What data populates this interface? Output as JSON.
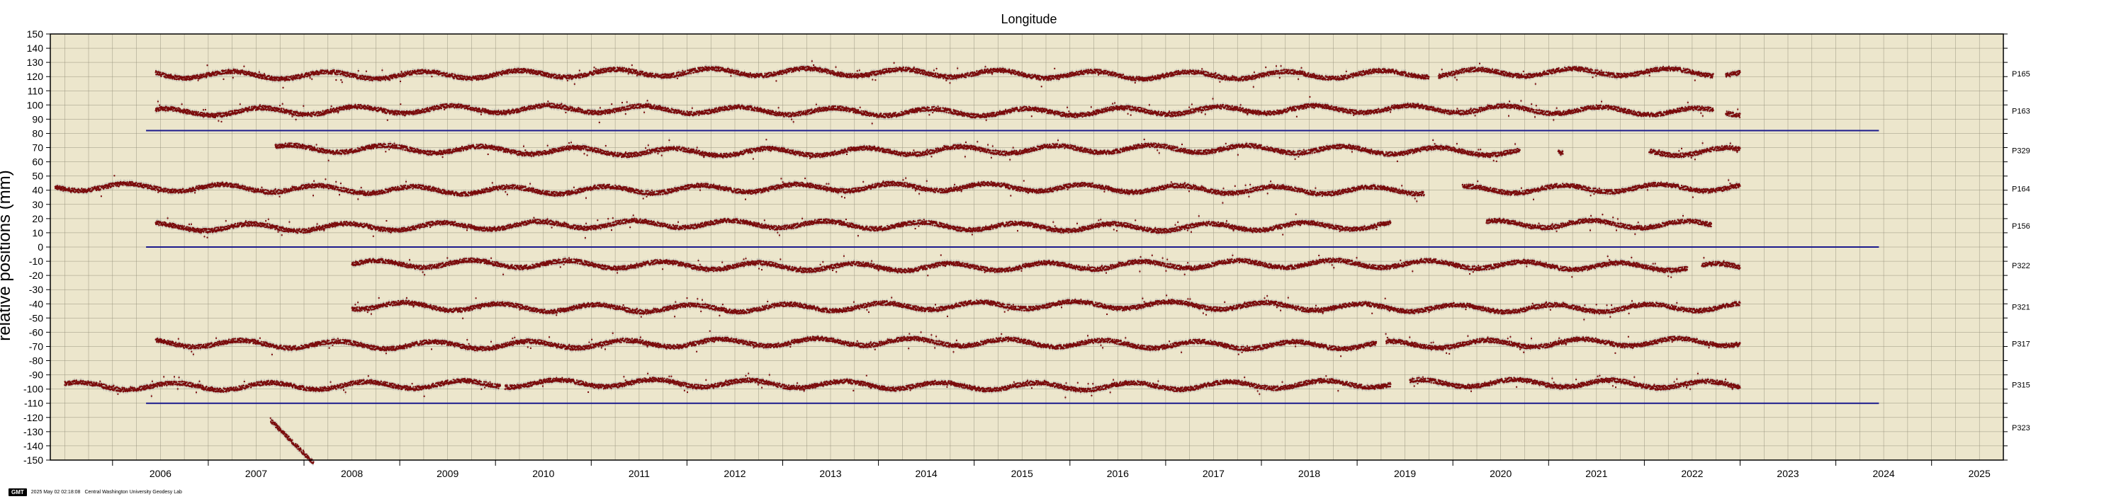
{
  "chart_data": {
    "type": "scatter",
    "title": "Longitude",
    "ylabel": "relative positions (mm)",
    "xlabel": "",
    "xlim": [
      2005.35,
      2025.75
    ],
    "ylim": [
      -150,
      150
    ],
    "x_ticks": [
      "2006",
      "2007",
      "2008",
      "2009",
      "2010",
      "2011",
      "2012",
      "2013",
      "2014",
      "2015",
      "2016",
      "2017",
      "2018",
      "2019",
      "2020",
      "2021",
      "2022",
      "2023",
      "2024",
      "2025"
    ],
    "y_ticks": [
      "150",
      "140",
      "130",
      "120",
      "110",
      "100",
      "90",
      "80",
      "70",
      "60",
      "50",
      "40",
      "30",
      "20",
      "10",
      "0",
      "-10",
      "-20",
      "-30",
      "-40",
      "-50",
      "-60",
      "-70",
      "-80",
      "-90",
      "-100",
      "-110",
      "-120",
      "-130",
      "-140",
      "-150"
    ],
    "grid": true,
    "background": "#ece6cc",
    "point_color": "#7a0a0a",
    "error_color": "#a8a8a8",
    "separator_color": "#1a1a8c",
    "separators": [
      {
        "y": 82,
        "x_start": 2006.35,
        "x_end": 2024.45
      },
      {
        "y": 0,
        "x_start": 2006.35,
        "x_end": 2024.45
      },
      {
        "y": -110,
        "x_start": 2006.35,
        "x_end": 2024.45
      }
    ],
    "series": [
      {
        "name": "P165",
        "offset": 122,
        "segments": [
          [
            2006.45,
            2019.75
          ],
          [
            2019.85,
            2022.72
          ],
          [
            2022.85,
            2023.0
          ]
        ]
      },
      {
        "name": "P163",
        "offset": 96,
        "segments": [
          [
            2006.45,
            2022.72
          ],
          [
            2022.85,
            2023.0
          ]
        ]
      },
      {
        "name": "P329",
        "offset": 68,
        "segments": [
          [
            2007.7,
            2020.7
          ],
          [
            2021.1,
            2021.15
          ],
          [
            2022.05,
            2023.0
          ]
        ]
      },
      {
        "name": "P164",
        "offset": 41,
        "segments": [
          [
            2005.4,
            2019.7
          ],
          [
            2020.1,
            2023.0
          ]
        ]
      },
      {
        "name": "P156",
        "offset": 15,
        "segments": [
          [
            2006.45,
            2019.35
          ],
          [
            2020.35,
            2022.7
          ]
        ]
      },
      {
        "name": "P322",
        "offset": -13,
        "segments": [
          [
            2008.5,
            2022.45
          ],
          [
            2022.6,
            2023.0
          ]
        ]
      },
      {
        "name": "P321",
        "offset": -42,
        "segments": [
          [
            2008.5,
            2023.0
          ]
        ]
      },
      {
        "name": "P317",
        "offset": -68,
        "segments": [
          [
            2006.45,
            2019.2
          ],
          [
            2019.3,
            2023.0
          ]
        ]
      },
      {
        "name": "P315",
        "offset": -97,
        "segments": [
          [
            2005.5,
            2010.05
          ],
          [
            2010.1,
            2019.35
          ],
          [
            2019.55,
            2023.0
          ]
        ]
      },
      {
        "name": "P323",
        "offset": -127,
        "segments": [
          [
            2007.65,
            2008.1
          ]
        ]
      }
    ]
  },
  "footer": {
    "logo": "GMT",
    "timestamp": "2025 May 02 02:18:08",
    "lab": "Central Washington University Geodesy Lab"
  }
}
